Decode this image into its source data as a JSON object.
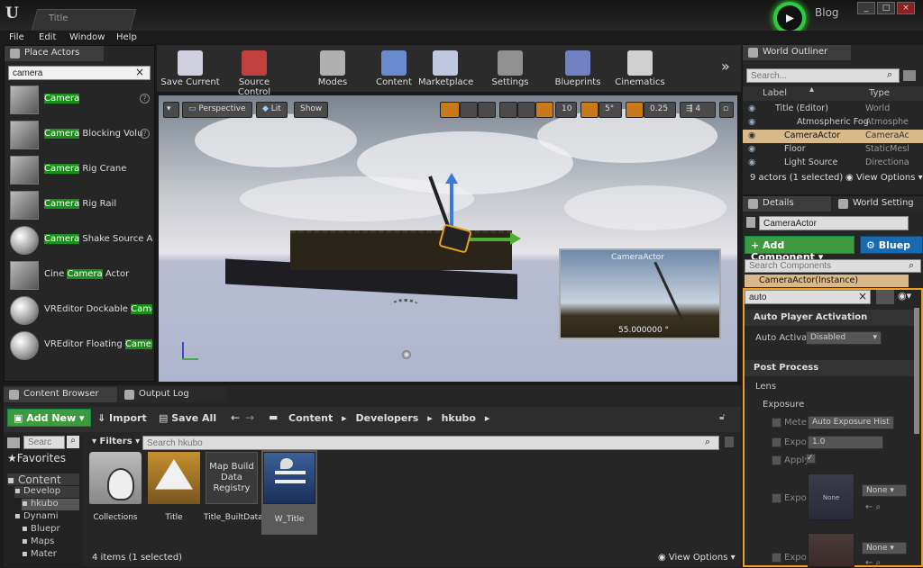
{
  "window": {
    "tab_title": "Title",
    "blog_label": "Blog",
    "controls": [
      "_",
      "□",
      "×"
    ]
  },
  "menu": [
    "File",
    "Edit",
    "Window",
    "Help"
  ],
  "place_actors": {
    "tab_label": "Place Actors",
    "search_value": "camera",
    "items": [
      {
        "highlight": "Camera",
        "rest": "",
        "shape": "cube",
        "help": true
      },
      {
        "highlight": "Camera",
        "rest": " Blocking Volu",
        "shape": "cube",
        "help": true
      },
      {
        "highlight": "Camera",
        "rest": " Rig Crane",
        "shape": "cube",
        "help": false
      },
      {
        "highlight": "Camera",
        "rest": " Rig Rail",
        "shape": "cube",
        "help": false
      },
      {
        "highlight": "Camera",
        "rest": " Shake Source A",
        "shape": "sphere",
        "help": false
      },
      {
        "prefix": "Cine ",
        "highlight": "Camera",
        "rest": " Actor",
        "shape": "cube",
        "help": false
      },
      {
        "prefix": "VREditor Dockable ",
        "highlight": "Came",
        "rest": "",
        "shape": "sphere",
        "help": false
      },
      {
        "prefix": "VREditor Floating ",
        "highlight": "Camera",
        "rest": "",
        "shape": "sphere",
        "help": false
      }
    ]
  },
  "toolbar": {
    "buttons": [
      {
        "label": "Save Current",
        "icon": "save-icon",
        "color": "#d0d0e0"
      },
      {
        "label": "Source Control",
        "icon": "source-control-icon",
        "color": "#c04040"
      },
      {
        "label": "Modes",
        "icon": "modes-icon",
        "color": "#b0b0b0"
      },
      {
        "label": "Content",
        "icon": "content-icon",
        "color": "#6a8ad0"
      },
      {
        "label": "Marketplace",
        "icon": "marketplace-icon",
        "color": "#c0c8e0"
      },
      {
        "label": "Settings",
        "icon": "settings-icon",
        "color": "#909090"
      },
      {
        "label": "Blueprints",
        "icon": "blueprints-icon",
        "color": "#7080c0"
      },
      {
        "label": "Cinematics",
        "icon": "cinematics-icon",
        "color": "#d0d0d0"
      }
    ]
  },
  "viewport": {
    "perspective": "Perspective",
    "lit": "Lit",
    "show": "Show",
    "grid_snap": "10",
    "rot_snap": "5°",
    "scale_snap": "0.25",
    "cam_speed": "4",
    "pip_label": "CameraActor",
    "pip_value": "55.000000 °"
  },
  "content_browser": {
    "tab_label": "Content Browser",
    "tab2_label": "Output Log",
    "add_new": "Add New",
    "import": "Import",
    "save_all": "Save All",
    "path": [
      "Content",
      "Developers",
      "hkubo"
    ],
    "search_placeholder": "Searc",
    "favorites": "Favorites",
    "filters": "Filters",
    "asset_search_placeholder": "Search hkubo",
    "tree": [
      "Content",
      "Develop",
      "hkubo",
      "Dynami",
      "Bluepr",
      "Maps",
      "Mater"
    ],
    "assets": [
      {
        "label": "Collections"
      },
      {
        "label": "Title"
      },
      {
        "label": "Title_BuiltData",
        "text": "Map Build Data Registry"
      },
      {
        "label": "W_Title"
      }
    ],
    "status": "4 items (1 selected)",
    "view_options": "View Options"
  },
  "outliner": {
    "tab_label": "World Outliner",
    "search_placeholder": "Search...",
    "col_label": "Label",
    "col_type": "Type",
    "rows": [
      {
        "label": "Title (Editor)",
        "type": "World",
        "selected": false
      },
      {
        "label": "Atmospheric Fog",
        "type": "Atmosphe",
        "selected": false
      },
      {
        "label": "CameraActor",
        "type": "CameraAc",
        "selected": true
      },
      {
        "label": "Floor",
        "type": "StaticMesh",
        "selected": false
      },
      {
        "label": "Light Source",
        "type": "Directiona",
        "selected": false
      }
    ],
    "count": "9 actors (1 selected)",
    "view_options": "View Options"
  },
  "details": {
    "tab_label": "Details",
    "tab2_label": "World Setting",
    "actor_name": "CameraActor",
    "add_component": "+ Add Component",
    "blueprint": "Bluep",
    "search_components": "Search Components",
    "instance": "CameraActor(Instance)",
    "filter_value": "auto",
    "sec1": "Auto Player Activation",
    "auto_activate_label": "Auto Activat",
    "auto_activate_value": "Disabled",
    "sec2": "Post Process",
    "lens": "Lens",
    "exposure": "Exposure",
    "metering": "Mete",
    "metering_value": "Auto Exposure Hist",
    "expo1": "Expo",
    "expo1_value": "1.0",
    "apply": "Apply",
    "expo2": "Expo",
    "expo3": "Expo",
    "none": "None"
  }
}
